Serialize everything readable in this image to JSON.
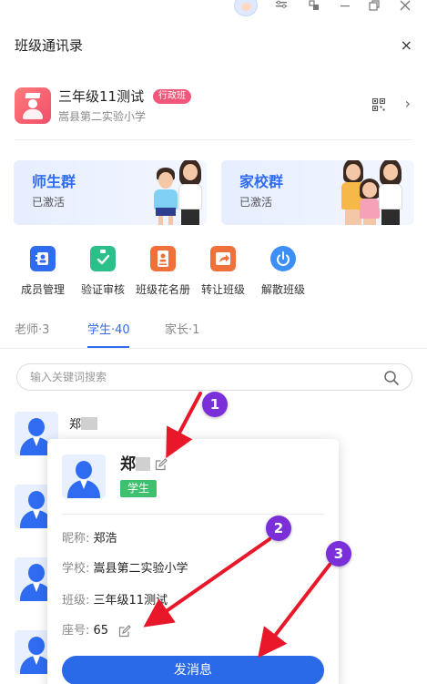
{
  "header": {
    "title": "班级通讯录",
    "close_glyph": "×"
  },
  "class_info": {
    "name": "三年级11测试",
    "tag": "行政班",
    "school": "嵩县第二实验小学",
    "chevron_glyph": "›"
  },
  "groups": [
    {
      "title": "师生群",
      "status": "已激活"
    },
    {
      "title": "家校群",
      "status": "已激活"
    }
  ],
  "actions": [
    {
      "label": "成员管理",
      "icon": "members-icon",
      "color": "#2f6cf2"
    },
    {
      "label": "验证审核",
      "icon": "clipboard-check-icon",
      "color": "#2bbf8a"
    },
    {
      "label": "班级花名册",
      "icon": "roster-icon",
      "color": "#f0703c"
    },
    {
      "label": "转让班级",
      "icon": "transfer-icon",
      "color": "#f0703c"
    },
    {
      "label": "解散班级",
      "icon": "power-icon",
      "color": "#3d8ef5"
    }
  ],
  "tabs": [
    {
      "label": "老师·3"
    },
    {
      "label": "学生·40"
    },
    {
      "label": "家长·1"
    }
  ],
  "search": {
    "placeholder": "输入关键词搜索"
  },
  "members": [
    {
      "name": "郑"
    }
  ],
  "popup": {
    "name": "郑",
    "role": "学生",
    "nickname_label": "昵称:",
    "nickname": "郑浩",
    "school_label": "学校:",
    "school": "嵩县第二实验小学",
    "class_label": "班级:",
    "class": "三年级11测试",
    "seat_label": "座号:",
    "seat": "65",
    "send_button": "发消息"
  },
  "annotations": [
    {
      "label": "1"
    },
    {
      "label": "2"
    },
    {
      "label": "3"
    }
  ],
  "colors": {
    "accent": "#2f6cf2",
    "student_badge": "#3ec06e",
    "class_tag": "#f0577a",
    "marker": "#7b2fd8",
    "arrow": "#e8182a"
  }
}
